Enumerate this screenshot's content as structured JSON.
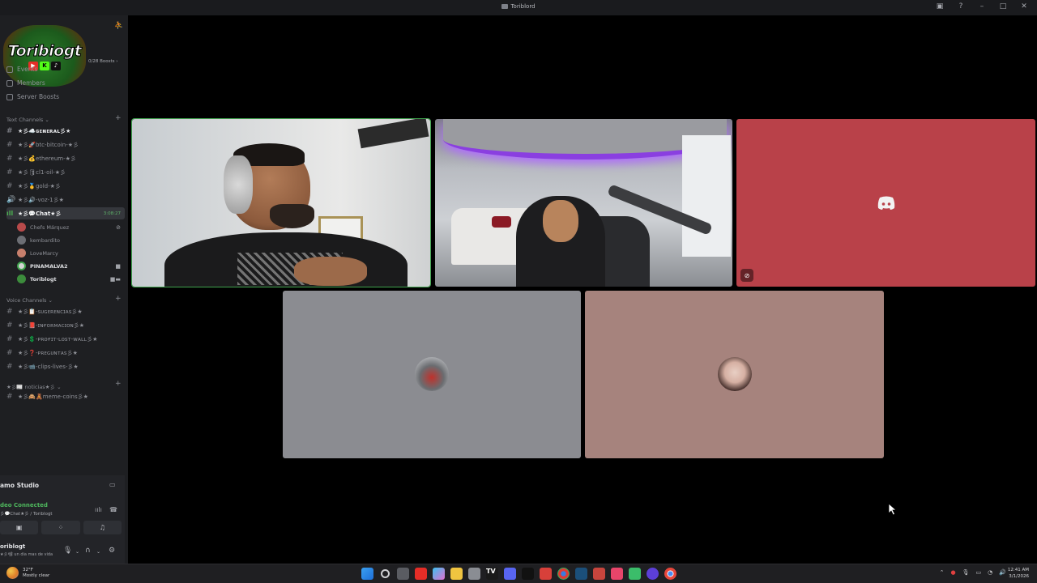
{
  "window": {
    "title": "Toriblord"
  },
  "titlebar_icons": [
    "inbox-icon",
    "help-icon",
    "minimize-icon",
    "maximize-icon",
    "close-icon"
  ],
  "server": {
    "name": "Toribiogt",
    "logo_text": "Toribiogt",
    "boosts": "0/28 Boosts"
  },
  "nav": [
    {
      "label": "Events"
    },
    {
      "label": "Members"
    },
    {
      "label": "Server Boosts"
    }
  ],
  "text_category": {
    "label": "Text Channels"
  },
  "text_channels": [
    {
      "label": "★彡☁️ɢᴇɴᴇʀᴀʟ彡★"
    },
    {
      "label": "★彡🚀btc-bitcoin-★彡"
    },
    {
      "label": "★彡💰ethereum-★彡"
    },
    {
      "label": "★彡🛢cl1-oil-★彡"
    },
    {
      "label": "★彡🥇gold-★彡"
    },
    {
      "label": "★彡🔊-voz-1彡★"
    }
  ],
  "voice_active": {
    "label": "★彡💬Chat★彡",
    "timer": "3:08:27"
  },
  "voice_members": [
    {
      "name": "Chefs Márquez",
      "color": "#b84a4a"
    },
    {
      "name": "kembardito",
      "color": "#6c6e74"
    },
    {
      "name": "LoveMarcy",
      "color": "#c77f6c"
    },
    {
      "name": "PINAMALVA2",
      "color": "#d4d4d4"
    },
    {
      "name": "Toriblogt",
      "color": "#3c8c3c"
    }
  ],
  "voice_category": {
    "label": "Voice Channels"
  },
  "voice_channels": [
    {
      "label": "★彡📋-sᴜɢᴇʀᴇɴᴄɪᴀs彡★"
    },
    {
      "label": "★彡📕-ɪɴғᴏʀᴍᴀᴄɪᴏɴ彡★"
    },
    {
      "label": "★彡💲-ᴘʀᴏғɪᴛ-ʟᴏsᴛ-ᴡᴀʟʟ彡★"
    },
    {
      "label": "★彡❓-ᴘʀᴇɢᴜɴᴛᴀs彡★"
    },
    {
      "label": "★彡📹-clips-lives-彡★"
    }
  ],
  "noticias_category": {
    "label": "★彡📰 noticias★彡"
  },
  "noticias_channels": [
    {
      "label": "★彡🙈🧸meme-coins彡★"
    }
  ],
  "panel": {
    "studio": "amo Studio",
    "connection": "deo Connected",
    "connection_sub": "彡💬Chat★彡 / Toriblogt",
    "user": "oriblogt",
    "status": "★彡📽 un dia mas de vida"
  },
  "taskbar": {
    "temp": "32°F",
    "weather": "Mostly clear",
    "time": "12:41 AM",
    "date": "3/1/2026"
  }
}
